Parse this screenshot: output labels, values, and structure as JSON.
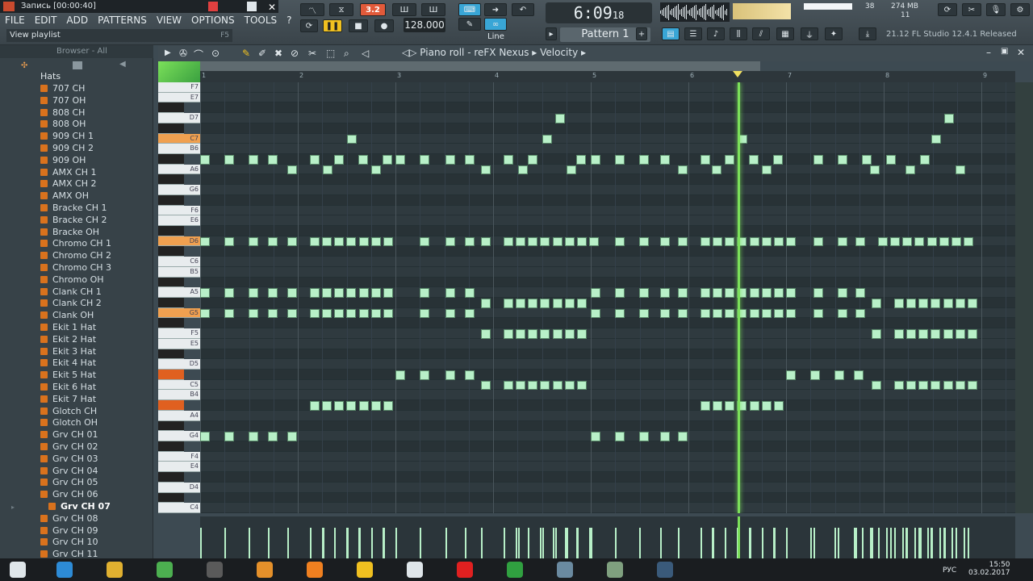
{
  "window": {
    "recording_title": "Запись [00:00:40]"
  },
  "menu": [
    "FILE",
    "EDIT",
    "ADD",
    "PATTERNS",
    "VIEW",
    "OPTIONS",
    "TOOLS",
    "?"
  ],
  "hint": {
    "text": "View playlist",
    "key": "F5"
  },
  "transport": {
    "time": "6:09",
    "time_sub": "18",
    "bpm": "128.000",
    "pattern": "Pattern 1",
    "snap": "Line",
    "counter": "3.2"
  },
  "status": {
    "cpu": "38",
    "memory": "274 MB",
    "polyphony": "11",
    "version": "21.12  FL Studio 12.4.1 Released"
  },
  "browser": {
    "header": "Browser - All",
    "folder": "Hats",
    "items": [
      "707 CH",
      "707 OH",
      "808 CH",
      "808 OH",
      "909 CH 1",
      "909 CH 2",
      "909 OH",
      "AMX CH 1",
      "AMX CH 2",
      "AMX OH",
      "Bracke CH 1",
      "Bracke CH 2",
      "Bracke OH",
      "Chromo CH 1",
      "Chromo CH 2",
      "Chromo CH 3",
      "Chromo OH",
      "Clank CH 1",
      "Clank CH 2",
      "Clank OH",
      "Ekit 1 Hat",
      "Ekit 2 Hat",
      "Ekit 3 Hat",
      "Ekit 4 Hat",
      "Ekit 5 Hat",
      "Ekit 6 Hat",
      "Ekit 7 Hat",
      "Glotch CH",
      "Glotch OH",
      "Grv CH 01",
      "Grv CH 02",
      "Grv CH 03",
      "Grv CH 04",
      "Grv CH 05",
      "Grv CH 06",
      "Grv CH 07",
      "Grv CH 08",
      "Grv CH 09",
      "Grv CH 10",
      "Grv CH 11"
    ],
    "selected": "Grv CH 07"
  },
  "piano_roll": {
    "title": "Piano roll - reFX Nexus",
    "target": "Velocity",
    "bars": [
      "1",
      "2",
      "3",
      "4",
      "5",
      "6",
      "7",
      "8",
      "9"
    ],
    "key_labels": [
      "F7",
      "E7",
      "D7",
      "C7",
      "B6",
      "A6",
      "G6",
      "F6",
      "E6",
      "D6",
      "C6",
      "B5",
      "A5",
      "G5",
      "F5",
      "E5",
      "D5",
      "C5",
      "B4",
      "A4",
      "G4",
      "F4",
      "E4",
      "D4",
      "C4"
    ],
    "playhead_bar": 6.5
  },
  "taskbar": {
    "language": "РУС",
    "time": "15:50",
    "date": "03.02.2017"
  },
  "colors": {
    "note": "#b8f0c8",
    "playhead": "#7be05a",
    "highlight_key": "#f0a050"
  }
}
